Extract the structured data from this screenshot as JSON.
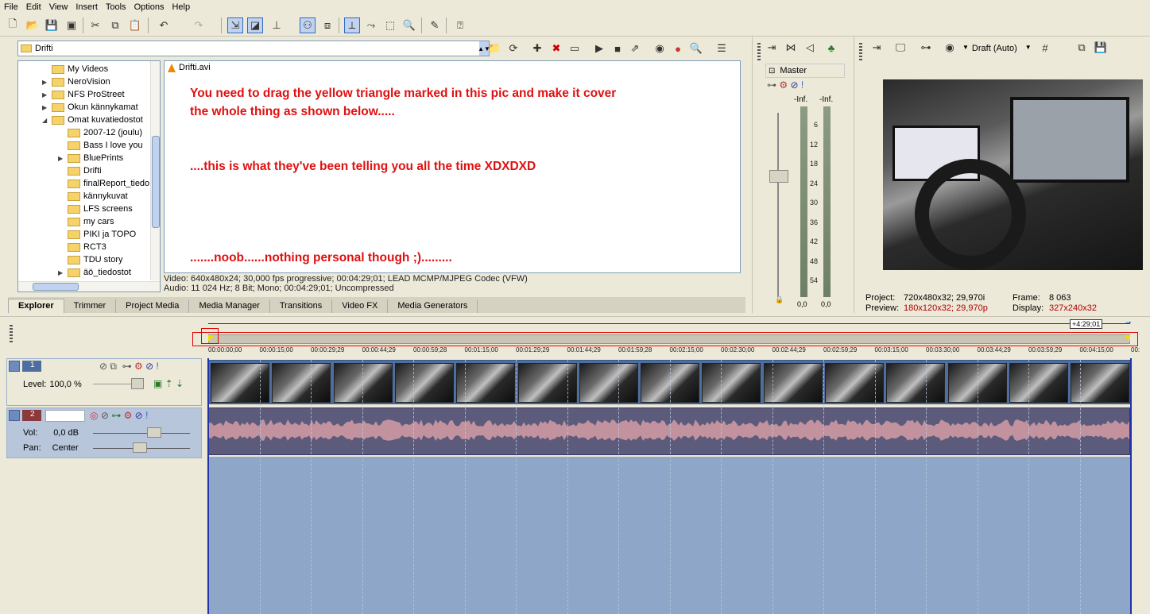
{
  "menu": [
    "File",
    "Edit",
    "View",
    "Insert",
    "Tools",
    "Options",
    "Help"
  ],
  "explorer": {
    "path": "Drifti",
    "tree": [
      {
        "label": "My Videos",
        "expander": ""
      },
      {
        "label": "NeroVision",
        "expander": "▶"
      },
      {
        "label": "NFS ProStreet",
        "expander": "▶"
      },
      {
        "label": "Okun kännykamat",
        "expander": "▶"
      },
      {
        "label": "Omat kuvatiedostot",
        "expander": "◢"
      },
      {
        "label": "2007-12 (joulu)",
        "expander": ""
      },
      {
        "label": "Bass I love you",
        "expander": ""
      },
      {
        "label": "BluePrints",
        "expander": "▶"
      },
      {
        "label": "Drifti",
        "expander": ""
      },
      {
        "label": "finalReport_tiedo",
        "expander": ""
      },
      {
        "label": "kännykuvat",
        "expander": ""
      },
      {
        "label": "LFS screens",
        "expander": ""
      },
      {
        "label": "my cars",
        "expander": ""
      },
      {
        "label": "PIKI ja TOPO",
        "expander": ""
      },
      {
        "label": "RCT3",
        "expander": ""
      },
      {
        "label": "TDU story",
        "expander": ""
      },
      {
        "label": "äö_tiedostot",
        "expander": "▶"
      }
    ],
    "file": "Drifti.avi",
    "annotations": [
      "You need to drag the yellow triangle marked in this pic and make it cover",
      "the whole thing as shown below.....",
      "....this is what they've been telling you all the time XDXDXD",
      ".......noob......nothing personal though ;).........",
      ""
    ],
    "video_info": "Video: 640x480x24; 30,000 fps progressive; 00:04:29;01; LEAD MCMP/MJPEG Codec (VFW)",
    "audio_info": "Audio: 11 024 Hz; 8 Bit; Mono; 00:04:29;01; Uncompressed",
    "tabs": [
      "Explorer",
      "Trimmer",
      "Project Media",
      "Media Manager",
      "Transitions",
      "Video FX",
      "Media Generators"
    ]
  },
  "mixer": {
    "label": "Master",
    "left_peak": "-Inf.",
    "right_peak": "-Inf.",
    "scale": [
      "6",
      "12",
      "18",
      "24",
      "30",
      "36",
      "42",
      "48",
      "54"
    ],
    "left_val": "0,0",
    "right_val": "0,0"
  },
  "preview": {
    "quality": "Draft (Auto)",
    "project_label": "Project:",
    "project_value": "720x480x32; 29,970i",
    "preview_label": "Preview:",
    "preview_value": "180x120x32; 29,970p",
    "frame_label": "Frame:",
    "frame_value": "8 063",
    "display_label": "Display:",
    "display_value": "327x240x32"
  },
  "timeline": {
    "loop_length": "+4:29;01",
    "ticks": [
      "00:00:00;00",
      "00:00:15;00",
      "00:00:29;29",
      "00:00:44;29",
      "00:00:59;28",
      "00:01:15;00",
      "00:01:29;29",
      "00:01:44;29",
      "00:01:59;28",
      "00:02:15;00",
      "00:02:30;00",
      "00:02:44;29",
      "00:02:59;29",
      "00:03:15;00",
      "00:03:30;00",
      "00:03:44;29",
      "00:03:59;29",
      "00:04:15;00",
      "00:"
    ],
    "video_track": {
      "number": "1",
      "level_label": "Level:",
      "level_value": "100,0 %"
    },
    "audio_track": {
      "number": "2",
      "vol_label": "Vol:",
      "vol_value": "0,0 dB",
      "pan_label": "Pan:",
      "pan_value": "Center"
    }
  },
  "colors": {
    "annotation": "#e01010",
    "video_track": "#4f6ea0",
    "audio_track": "#5c5b7c",
    "empty_track": "#8ea7c8"
  }
}
